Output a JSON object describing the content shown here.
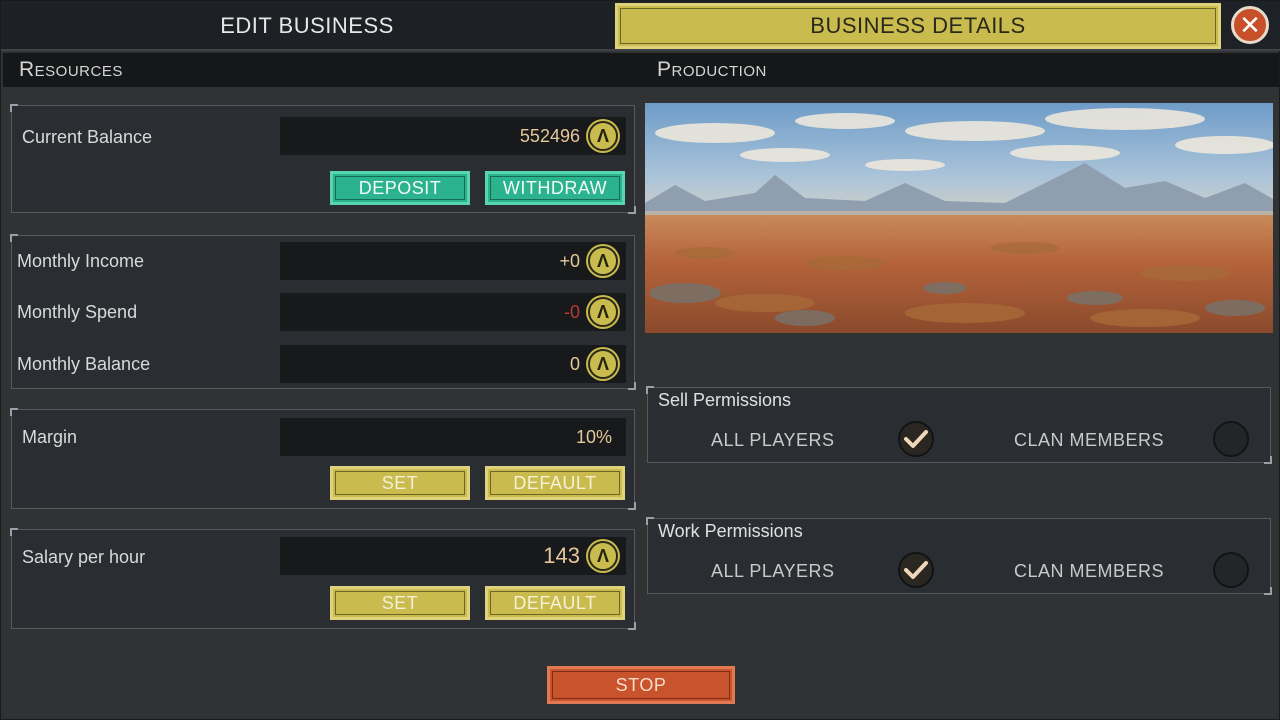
{
  "tabs": {
    "edit_business": "EDIT BUSINESS",
    "business_details": "BUSINESS DETAILS"
  },
  "close_icon": "close-icon",
  "resources": {
    "header": "Resources",
    "current_balance": {
      "label": "Current Balance",
      "value": "552496",
      "deposit_label": "DEPOSIT",
      "withdraw_label": "WITHDRAW"
    },
    "monthly": {
      "income_label": "Monthly Income",
      "income_value": "+0",
      "spend_label": "Monthly Spend",
      "spend_value": "-0",
      "balance_label": "Monthly Balance",
      "balance_value": "0"
    },
    "margin": {
      "label": "Margin",
      "value": "10%",
      "set_label": "SET",
      "default_label": "DEFAULT"
    },
    "salary": {
      "label": "Salary per hour",
      "value": "143",
      "set_label": "SET",
      "default_label": "DEFAULT"
    }
  },
  "production": {
    "header": "Production",
    "sell_permissions": {
      "title": "Sell Permissions",
      "all_players_label": "ALL PLAYERS",
      "all_players_checked": true,
      "clan_members_label": "CLAN MEMBERS",
      "clan_members_checked": false
    },
    "work_permissions": {
      "title": "Work Permissions",
      "all_players_label": "ALL PLAYERS",
      "all_players_checked": true,
      "clan_members_label": "CLAN MEMBERS",
      "clan_members_checked": false
    }
  },
  "stop_label": "STOP",
  "colors": {
    "accent_yellow": "#c9bb4e",
    "accent_teal": "#2bb38f",
    "stop_orange": "#c9532c",
    "negative_red": "#b83a32",
    "value_text": "#e4c79a"
  }
}
